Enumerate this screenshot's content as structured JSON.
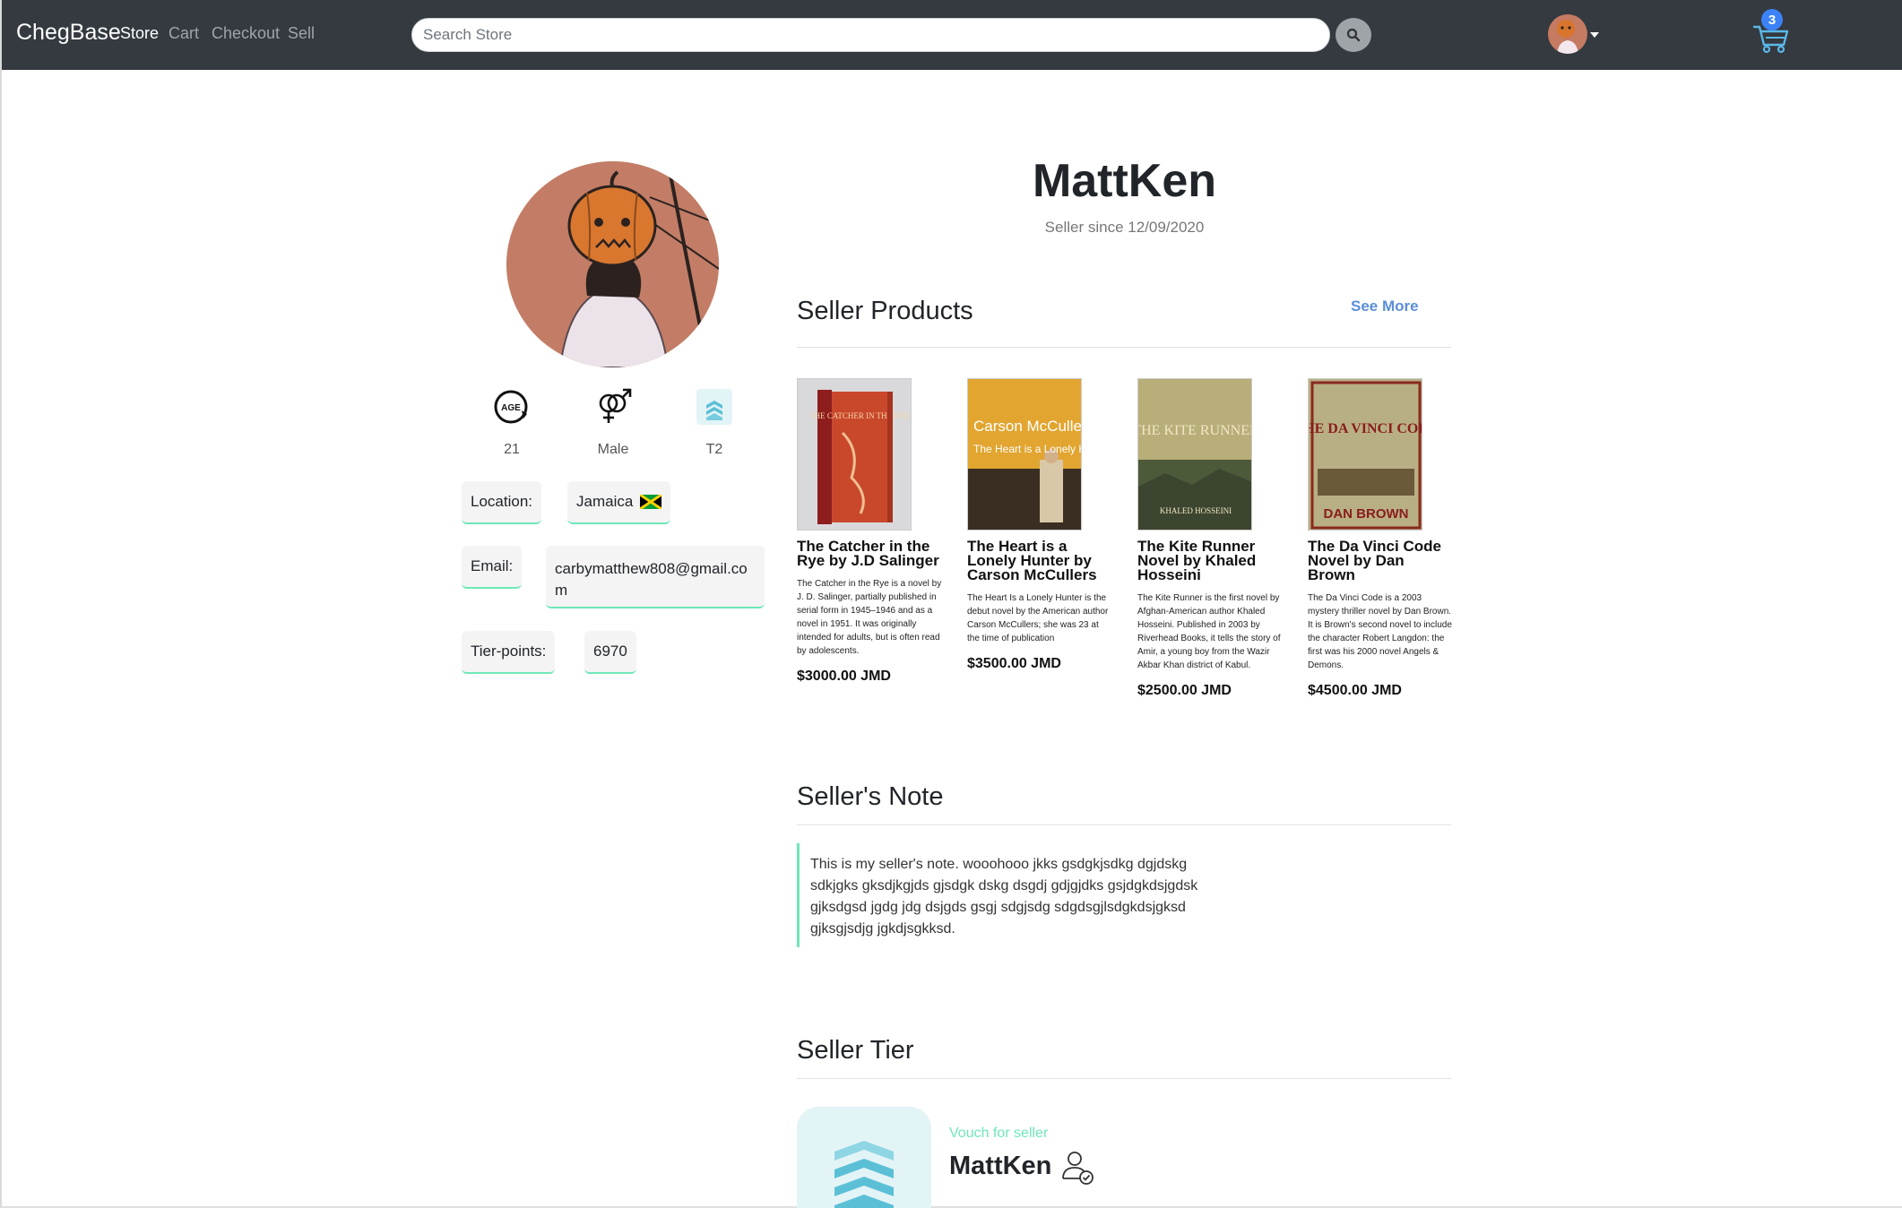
{
  "nav": {
    "brand": "ChegBase",
    "links": [
      "Store",
      "Cart",
      "Checkout",
      "Sell"
    ],
    "search_placeholder": "Search Store",
    "cart_count": "3"
  },
  "profile": {
    "username": "MattKen",
    "since": "Seller since 12/09/2020",
    "age": "21",
    "gender": "Male",
    "tier": "T2",
    "location_label": "Location:",
    "location_value": "Jamaica",
    "email_label": "Email:",
    "email_line1": "carbymatthew808@gmail.co",
    "email_line2": "m",
    "tierpoints_label": "Tier-points:",
    "tierpoints_value": "6970"
  },
  "products_section": {
    "title": "Seller Products",
    "see_more": "See More",
    "items": [
      {
        "title": "The Catcher in the Rye by J.D Salinger",
        "description": "The Catcher in the Rye is a novel by J. D. Salinger, partially published in serial form in 1945–1946 and as a novel in 1951. It was originally intended for adults, but is often read by adolescents.",
        "price": "$3000.00 JMD"
      },
      {
        "title": "The Heart is a Lonely Hunter by Carson McCullers",
        "description": "The Heart Is a Lonely Hunter is the debut novel by the American author Carson McCullers; she was 23 at the time of publication",
        "price": "$3500.00 JMD"
      },
      {
        "title": "The Kite Runner Novel by Khaled Hosseini",
        "description": "The Kite Runner is the first novel by Afghan-American author Khaled Hosseini. Published in 2003 by Riverhead Books, it tells the story of Amir, a young boy from the Wazir Akbar Khan district of Kabul.",
        "price": "$2500.00 JMD"
      },
      {
        "title": "The Da Vinci Code Novel by Dan Brown",
        "description": "The Da Vinci Code is a 2003 mystery thriller novel by Dan Brown. It is Brown's second novel to include the character Robert Langdon: the first was his 2000 novel Angels & Demons.",
        "price": "$4500.00 JMD"
      }
    ]
  },
  "note_section": {
    "title": "Seller's Note",
    "lines": [
      "This is my seller's note. wooohooo jkks gsdgkjsdkg dgjdskg",
      "sdkjgks gksdjkgjds gjsdgk dskg dsgdj gdjgjdks gsjdgkdsjgdsk",
      "gjksdgsd jgdg jdg dsjgds gsgj sdgjsdg sdgdsgjlsdgkdsjgksd",
      "gjksgjsdjg jgkdjsgkksd."
    ]
  },
  "tier_section": {
    "title": "Seller Tier",
    "vouch_label": "Vouch for seller",
    "name": "MattKen"
  },
  "cover_text": {
    "catcher": "THE CATCHER IN THE RYE",
    "heart_author": "Carson McCullers",
    "heart_title": "The Heart is a Lonely Hunter",
    "kite_title": "THE KITE RUNNER",
    "kite_author": "KHALED HOSSEINI",
    "davinci_title": "THE DA VINCI CODE",
    "davinci_author": "DAN BROWN"
  },
  "colors": {
    "navbar": "#343a40",
    "accent_green": "#6ee7b7",
    "link_blue": "#5b8fd8",
    "badge_blue": "#3b82f6",
    "tier_teal": "#5bc0d6"
  },
  "icons": {
    "search": "search-icon",
    "cart": "cart-icon",
    "age": "age-icon",
    "gender": "gender-icon",
    "tier": "tier-chevron-icon",
    "vouch": "user-check-icon"
  }
}
